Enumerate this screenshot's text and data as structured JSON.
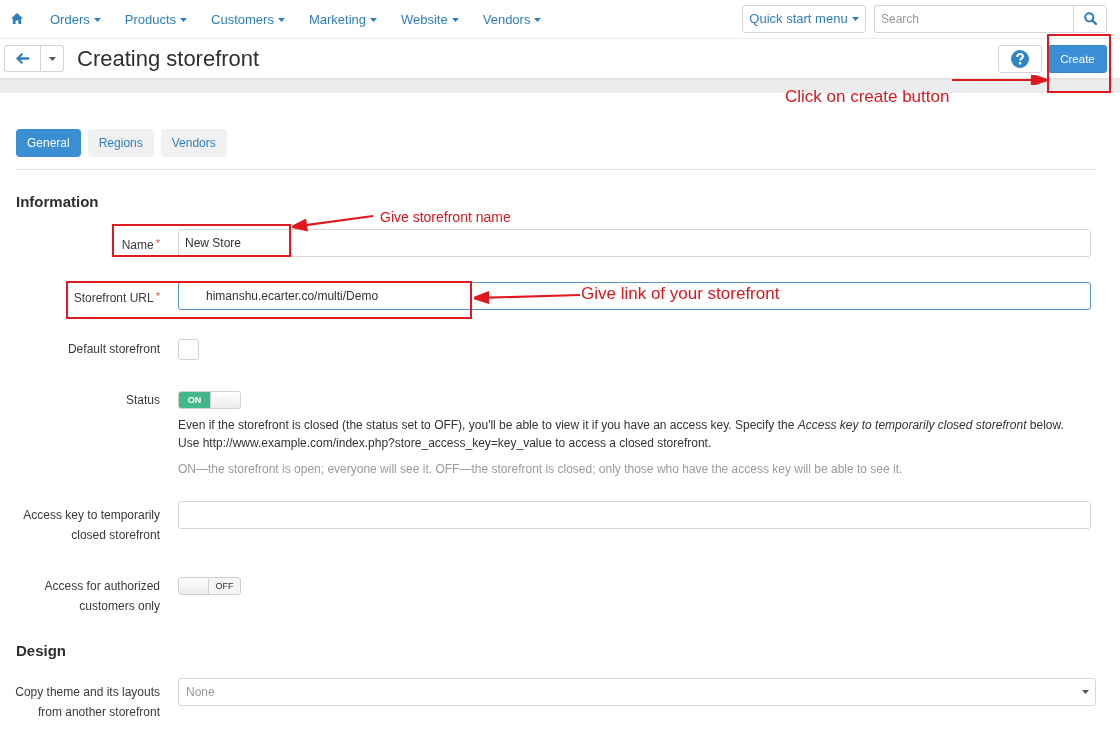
{
  "top_nav": {
    "menu": [
      {
        "label": "Orders"
      },
      {
        "label": "Products"
      },
      {
        "label": "Customers"
      },
      {
        "label": "Marketing"
      },
      {
        "label": "Website"
      },
      {
        "label": "Vendors"
      }
    ],
    "quick_start_button": "Quick start menu",
    "search": {
      "placeholder": "Search"
    }
  },
  "header": {
    "title": "Creating storefront",
    "create_button": "Create"
  },
  "tabs": [
    {
      "label": "General",
      "selected": true
    },
    {
      "label": "Regions",
      "selected": false
    },
    {
      "label": "Vendors",
      "selected": false
    }
  ],
  "sections": [
    {
      "title": "Information",
      "fields": [
        {
          "kind": "text",
          "label": "Name",
          "required_mark": "*",
          "value": "New Store",
          "focused": false
        },
        {
          "kind": "url",
          "label": "Storefront URL",
          "required_mark": "*",
          "value": "himanshu.ecarter.co/multi/Demo",
          "focused": true
        },
        {
          "kind": "checkbox",
          "label": "Default storefront",
          "checked": false
        },
        {
          "kind": "toggle",
          "label": "Status",
          "on": true,
          "toggle_text": "ON",
          "help": [
            "Even if the storefront is closed (the status set to OFF), you'll be able to view it if you have an access key. Specify the *Access key to temporarily closed storefront* below.",
            "Use http://www.example.com/index.php?store_access_key=key_value to access a closed storefront."
          ],
          "note": "ON—the storefront is open; everyone will see it. OFF—the storefront is closed; only those who have the access key will be able to see it."
        },
        {
          "kind": "text",
          "label": "Access key to temporarily closed storefront",
          "focused": false
        },
        {
          "kind": "toggle",
          "label": "Access for authorized customers only",
          "on": false,
          "toggle_text": "OFF"
        }
      ]
    },
    {
      "title": "Design",
      "fields": [
        {
          "kind": "select",
          "label": "Copy theme and its layouts from another storefront",
          "placeholder": "None"
        }
      ]
    }
  ],
  "annotations": [
    {
      "text": "Click on create button"
    },
    {
      "text": "Give storefront name"
    },
    {
      "text": "Give link of your storefront"
    }
  ]
}
